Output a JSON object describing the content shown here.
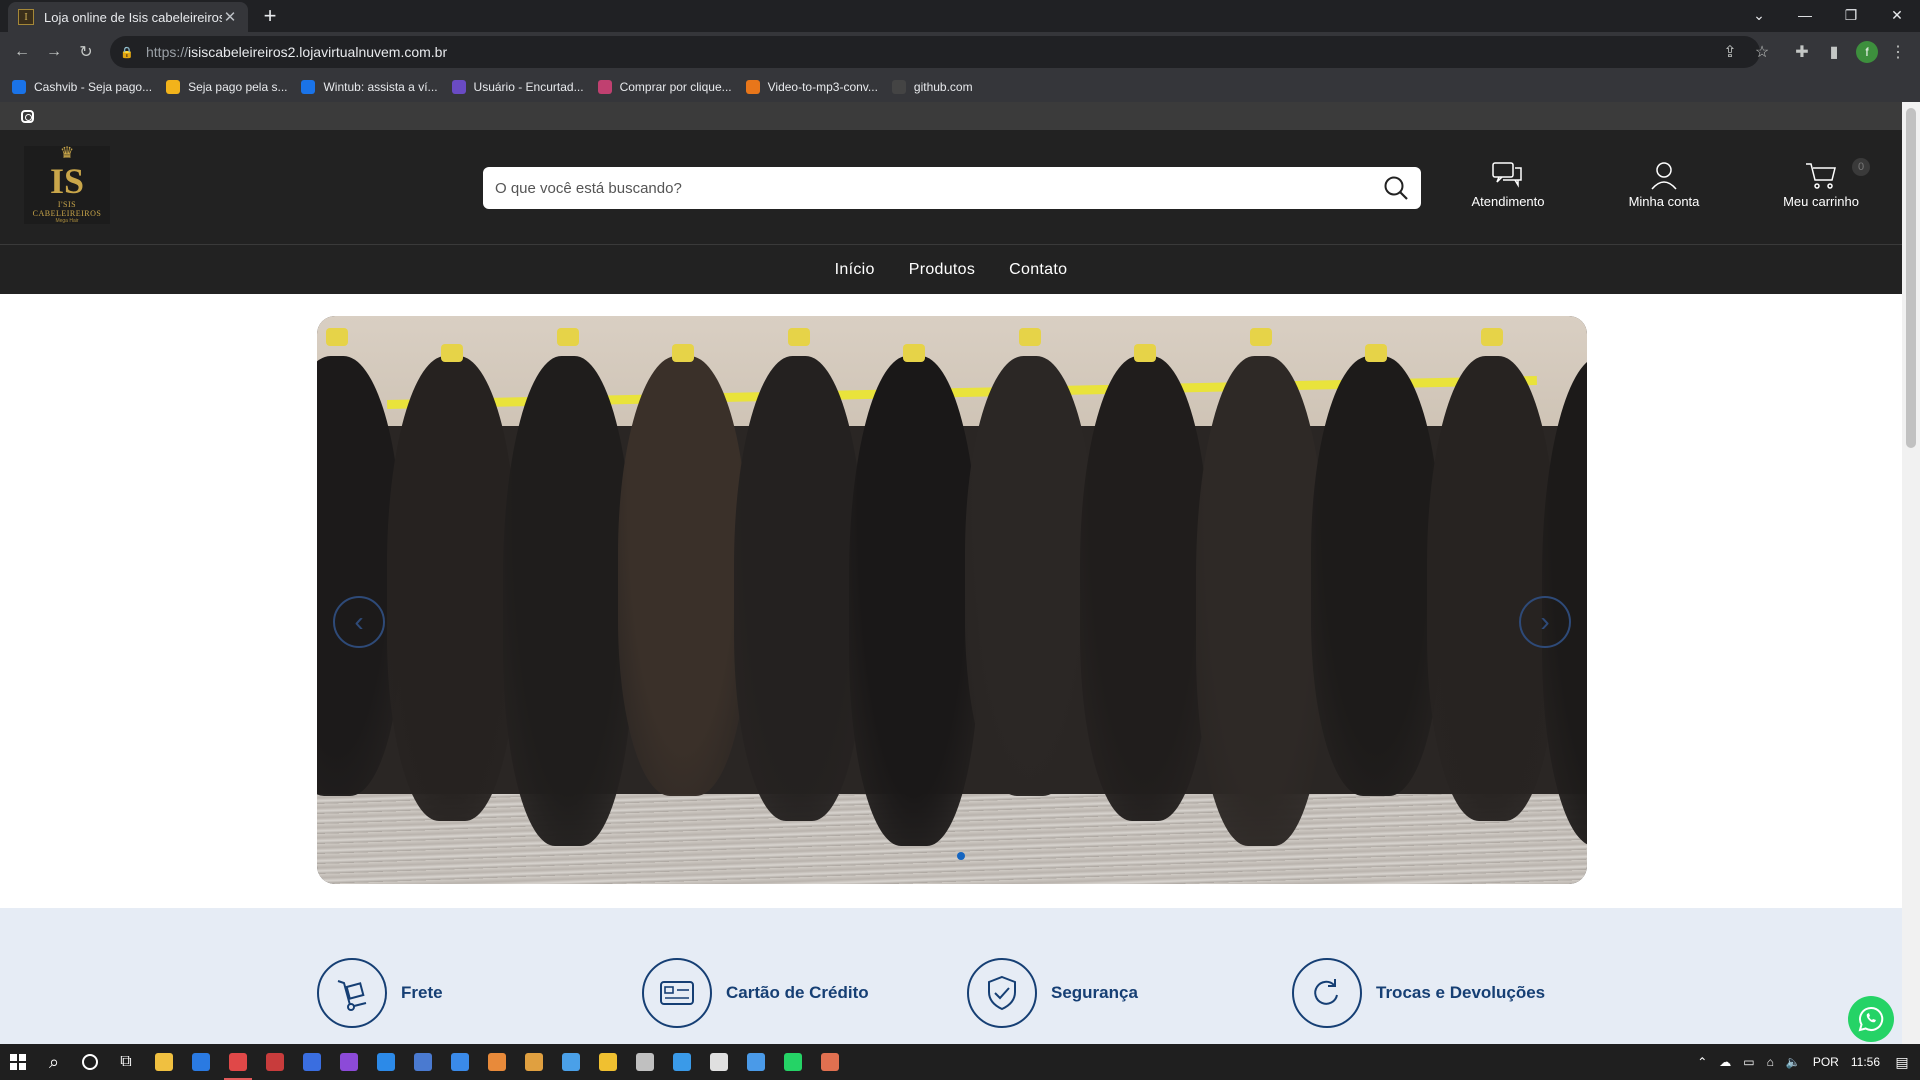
{
  "browser": {
    "tab_title": "Loja online de Isis cabeleireiros",
    "url_scheme": "https://",
    "url_host": "isiscabeleireiros2.lojavirtualnuvem.com.br",
    "profile_initial": "f",
    "bookmarks": [
      {
        "label": "Cashvib - Seja pago...",
        "color": "#1a73e8"
      },
      {
        "label": "Seja pago pela s...",
        "color": "#f2b31b"
      },
      {
        "label": "Wintub: assista a ví...",
        "color": "#1a73e8"
      },
      {
        "label": "Usuário - Encurtad...",
        "color": "#6a4bc4"
      },
      {
        "label": "Comprar por clique...",
        "color": "#c04070"
      },
      {
        "label": "Video-to-mp3-conv...",
        "color": "#e8761a"
      },
      {
        "label": "github.com",
        "color": "#444444"
      }
    ]
  },
  "store": {
    "logo": {
      "monogram": "IS",
      "name": "I'SIS CABELEIREIROS",
      "tagline": "Mega Hair"
    },
    "search_placeholder": "O que você está buscando?",
    "actions": {
      "support": "Atendimento",
      "account": "Minha conta",
      "cart": "Meu carrinho",
      "cart_count": "0"
    },
    "nav": [
      "Início",
      "Produtos",
      "Contato"
    ],
    "benefits": [
      "Frete",
      "Cartão de Crédito",
      "Segurança",
      "Trocas e Devoluções"
    ],
    "colors": {
      "header": "#222222",
      "accent": "#163f74",
      "benefits_bg": "#e6ecf5",
      "whatsapp": "#25d366"
    }
  },
  "taskbar": {
    "lang": "POR",
    "time": "11:56"
  }
}
